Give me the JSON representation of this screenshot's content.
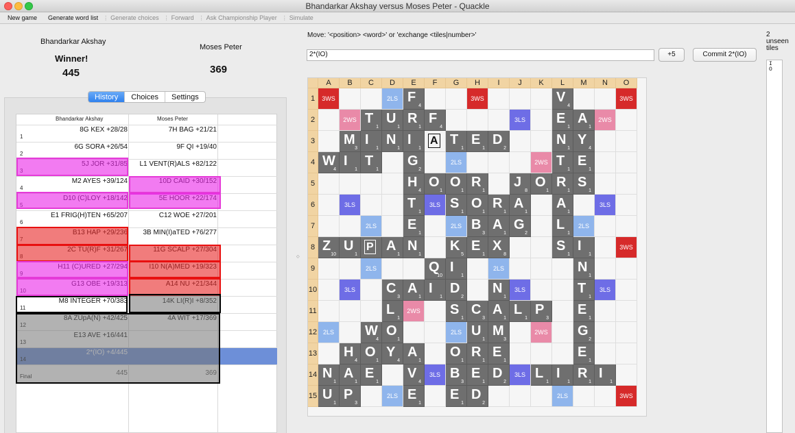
{
  "window": {
    "title": "Bhandarkar Akshay versus Moses Peter - Quackle"
  },
  "toolbar": {
    "items": [
      {
        "label": "New game",
        "enabled": true
      },
      {
        "label": "Generate word list",
        "enabled": true
      },
      {
        "label": "Generate choices",
        "enabled": false
      },
      {
        "label": "Forward",
        "enabled": false
      },
      {
        "label": "Ask Championship Player",
        "enabled": false
      },
      {
        "label": "Simulate",
        "enabled": false
      }
    ]
  },
  "players": [
    {
      "name": "Bhandarkar Akshay",
      "status": "Winner!",
      "score": "445"
    },
    {
      "name": "Moses Peter",
      "status": "",
      "score": "369"
    }
  ],
  "tabs": [
    {
      "label": "History",
      "active": true
    },
    {
      "label": "Choices",
      "active": false
    },
    {
      "label": "Settings",
      "active": false
    }
  ],
  "history": {
    "headers": [
      "Bhandarkar Akshay",
      "Moses Peter"
    ],
    "rows": [
      {
        "num": "1",
        "p1": "8G KEX  +28/28",
        "p2": "7H BAG  +21/21"
      },
      {
        "num": "2",
        "p1": "6G SORA  +26/54",
        "p2": "9F QI  +19/40"
      },
      {
        "num": "3",
        "p1": "5J JOR  +31/85",
        "p2": "L1 VENT(R)ALS  +82/122"
      },
      {
        "num": "4",
        "p1": "M2 AYES  +39/124",
        "p2": "10D CAID  +30/152"
      },
      {
        "num": "5",
        "p1": "D10 (C)LOY  +18/142",
        "p2": "5E HOOR  +22/174"
      },
      {
        "num": "6",
        "p1": "E1 FRIG(H)TEN  +65/207",
        "p2": "C12 WOE  +27/201"
      },
      {
        "num": "7",
        "p1": "B13 HAP  +29/236",
        "p2": "3B MIN(I)aTED  +76/277"
      },
      {
        "num": "8",
        "p1": "2C TU(R)F  +31/267",
        "p2": "11G SCALP  +27/304"
      },
      {
        "num": "9",
        "p1": "H11 (C)URED  +27/294",
        "p2": "I10 N(A)MED  +19/323"
      },
      {
        "num": "10",
        "p1": "G13 OBE  +19/313",
        "p2": "A14 NU  +21/344"
      },
      {
        "num": "11",
        "p1": "M8 INTEGER  +70/383",
        "p2": "14K LI(R)I  +8/352"
      },
      {
        "num": "12",
        "p1": "8A ZUpA(N)  +42/425",
        "p2": "4A WIT  +17/369"
      },
      {
        "num": "13",
        "p1": "E13 AVE  +16/441",
        "p2": ""
      },
      {
        "num": "14",
        "p1": "2*(IO)  +4/445",
        "p2": ""
      },
      {
        "num": "Final",
        "p1": "445",
        "p2": "369"
      }
    ]
  },
  "move": {
    "hint": "Move: '<position> <word>' or 'exchange <tiles|number>'",
    "value": "2*(IO)",
    "delta_button": "+5",
    "commit_button": "Commit 2*(IO)"
  },
  "unseen": {
    "label_count": "2",
    "label_word1": "unseen",
    "label_word2": "tiles",
    "tiles": "I O"
  },
  "board": {
    "columns": [
      "A",
      "B",
      "C",
      "D",
      "E",
      "F",
      "G",
      "H",
      "I",
      "J",
      "K",
      "L",
      "M",
      "N",
      "O"
    ],
    "rows_labels": [
      "1",
      "2",
      "3",
      "4",
      "5",
      "6",
      "7",
      "8",
      "9",
      "10",
      "11",
      "12",
      "13",
      "14",
      "15"
    ],
    "premium_colors": {
      "3WS": "#d62a2a",
      "2WS": "#e98aa8",
      "3LS": "#6e6de6",
      "2LS": "#8fb5ec"
    },
    "tile_color": "#6f6f6f",
    "premiums": [
      "3WS|||2LS||||3WS||||2LS|||3WS",
      "|2WS||||3LS||||3LS||||2WS|",
      "||2WS||||2LS||2LS||||2WS||",
      "2LS||2WS||||2LS||||2WS||2LS",
      "||||2WS||||||2WS||||",
      "|3LS||||3LS||||3LS||||3LS|",
      "||2LS||||2LS||2LS||||2LS||",
      "3WS|||2LS||||||||2LS|||3WS",
      "||2LS||||2LS||2LS||||2LS||",
      "|3LS||||3LS||||3LS||||3LS|",
      "||||2WS||||||2WS||||",
      "2LS||2WS||||2LS||||2WS||2LS",
      "||2WS||||2LS||2LS||||2WS||",
      "|2WS||||3LS||||3LS||||2WS|",
      "3WS|||2LS||||3WS||||2LS|||3WS"
    ],
    "rows": [
      [
        "",
        "",
        "",
        "",
        "F",
        "",
        "",
        "",
        "",
        "",
        "",
        "V",
        "",
        "",
        ""
      ],
      [
        "",
        "",
        "T",
        "U",
        "R",
        "F",
        "",
        "",
        "",
        "",
        "",
        "E",
        "A",
        "",
        ""
      ],
      [
        "",
        "M",
        "I",
        "N",
        "I",
        "a",
        "T",
        "E",
        "D",
        "",
        "",
        "N",
        "Y",
        "",
        ""
      ],
      [
        "W",
        "I",
        "T",
        "",
        "G",
        "",
        "",
        "",
        "",
        "",
        "",
        "T",
        "E",
        "",
        ""
      ],
      [
        "",
        "",
        "",
        "",
        "H",
        "O",
        "O",
        "R",
        "",
        "J",
        "O",
        "R",
        "S",
        "",
        ""
      ],
      [
        "",
        "",
        "",
        "",
        "T",
        "",
        "S",
        "O",
        "R",
        "A",
        "",
        "A",
        "",
        "",
        ""
      ],
      [
        "",
        "",
        "",
        "",
        "E",
        "",
        "",
        "B",
        "A",
        "G",
        "",
        "L",
        "",
        "",
        ""
      ],
      [
        "Z",
        "U",
        "p",
        "A",
        "N",
        "",
        "K",
        "E",
        "X",
        "",
        "",
        "S",
        "I",
        "",
        ""
      ],
      [
        "",
        "",
        "",
        "",
        "",
        "Q",
        "I",
        "",
        "",
        "",
        "",
        "",
        "N",
        "",
        ""
      ],
      [
        "",
        "",
        "",
        "C",
        "A",
        "I",
        "D",
        "",
        "N",
        "",
        "",
        "",
        "T",
        "",
        ""
      ],
      [
        "",
        "",
        "",
        "L",
        "",
        "",
        "S",
        "C",
        "A",
        "L",
        "P",
        "",
        "E",
        "",
        ""
      ],
      [
        "",
        "",
        "W",
        "O",
        "",
        "",
        "",
        "U",
        "M",
        "",
        "",
        "",
        "G",
        "",
        ""
      ],
      [
        "",
        "H",
        "O",
        "Y",
        "A",
        "",
        "O",
        "R",
        "E",
        "",
        "",
        "",
        "E",
        "",
        ""
      ],
      [
        "N",
        "A",
        "E",
        "",
        "V",
        "",
        "B",
        "E",
        "D",
        "",
        "L",
        "I",
        "R",
        "I",
        ""
      ],
      [
        "U",
        "P",
        "",
        "",
        "E",
        "",
        "E",
        "D",
        "",
        "",
        "",
        "",
        "",
        "",
        ""
      ]
    ],
    "points": {
      "A": "1",
      "B": "3",
      "C": "3",
      "D": "2",
      "E": "1",
      "F": "4",
      "G": "2",
      "H": "4",
      "I": "1",
      "J": "8",
      "K": "5",
      "L": "1",
      "M": "3",
      "N": "1",
      "O": "1",
      "P": "3",
      "Q": "10",
      "R": "1",
      "S": "1",
      "T": "1",
      "U": "1",
      "V": "4",
      "W": "4",
      "X": "8",
      "Y": "4",
      "Z": "10"
    }
  }
}
